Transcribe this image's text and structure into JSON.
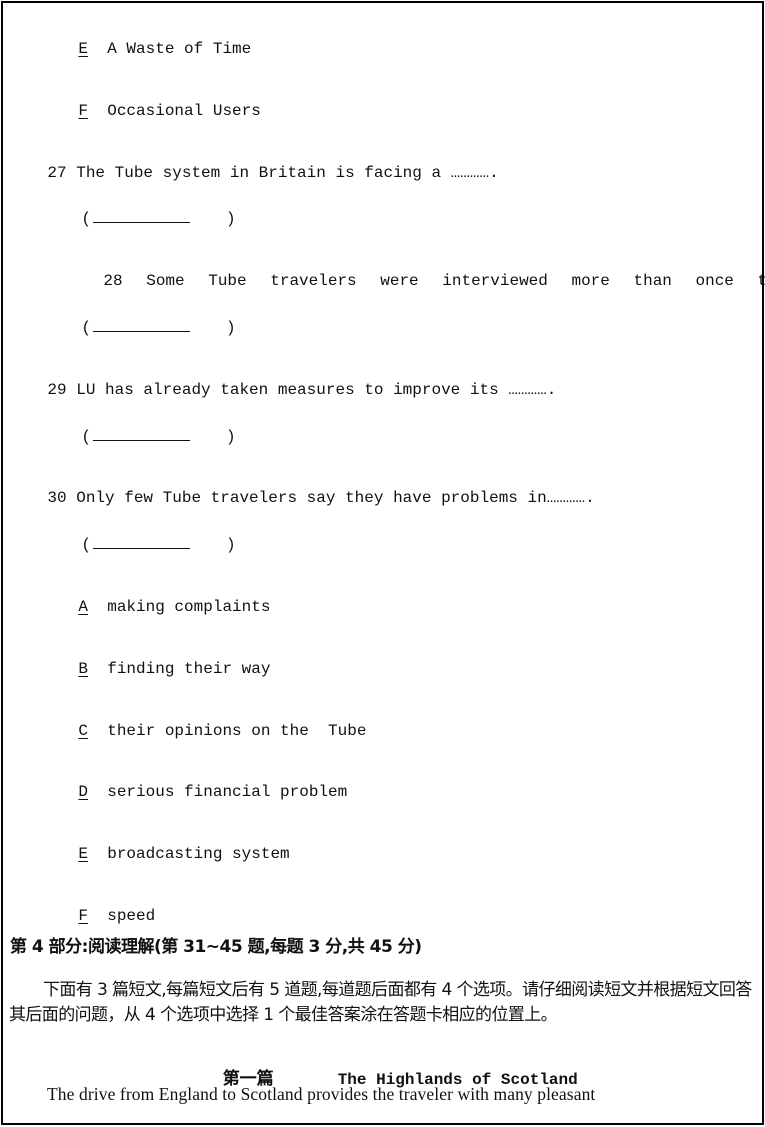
{
  "previous_options": [
    {
      "letter": "E",
      "text": "A Waste of Time"
    },
    {
      "letter": "F",
      "text": "Occasional Users"
    }
  ],
  "questions": [
    {
      "number": "27",
      "text": "The Tube system in Britain is facing a …………."
    },
    {
      "number": "28",
      "text": "Some Tube travelers were interviewed more than once to get ……"
    },
    {
      "number": "29",
      "text": "LU has already taken measures to improve its …………."
    },
    {
      "number": "30",
      "text": "Only few Tube travelers say they have problems in…………."
    }
  ],
  "answer_blank": {
    "open": "(",
    "close": ")"
  },
  "options": [
    {
      "letter": "A",
      "text": "making complaints"
    },
    {
      "letter": "B",
      "text": "finding their way"
    },
    {
      "letter": "C",
      "text": "their opinions on the  Tube"
    },
    {
      "letter": "D",
      "text": "serious financial problem"
    },
    {
      "letter": "E",
      "text": "broadcasting system"
    },
    {
      "letter": "F",
      "text": "speed"
    }
  ],
  "section": {
    "heading": "第 4 部分:阅读理解(第 31~45 题,每题 3 分,共 45 分)",
    "instructions": "下面有 3 篇短文,每篇短文后有 5 道题,每道题后面都有 4 个选项。请仔细阅读短文并根据短文回答其后面的问题，从 4 个选项中选择 1 个最佳答案涂在答题卡相应的位置上。"
  },
  "passage": {
    "label": "第一篇",
    "title": "The Highlands of Scotland",
    "first_line": "The drive from England to Scotland provides the traveler with many pleasant"
  }
}
